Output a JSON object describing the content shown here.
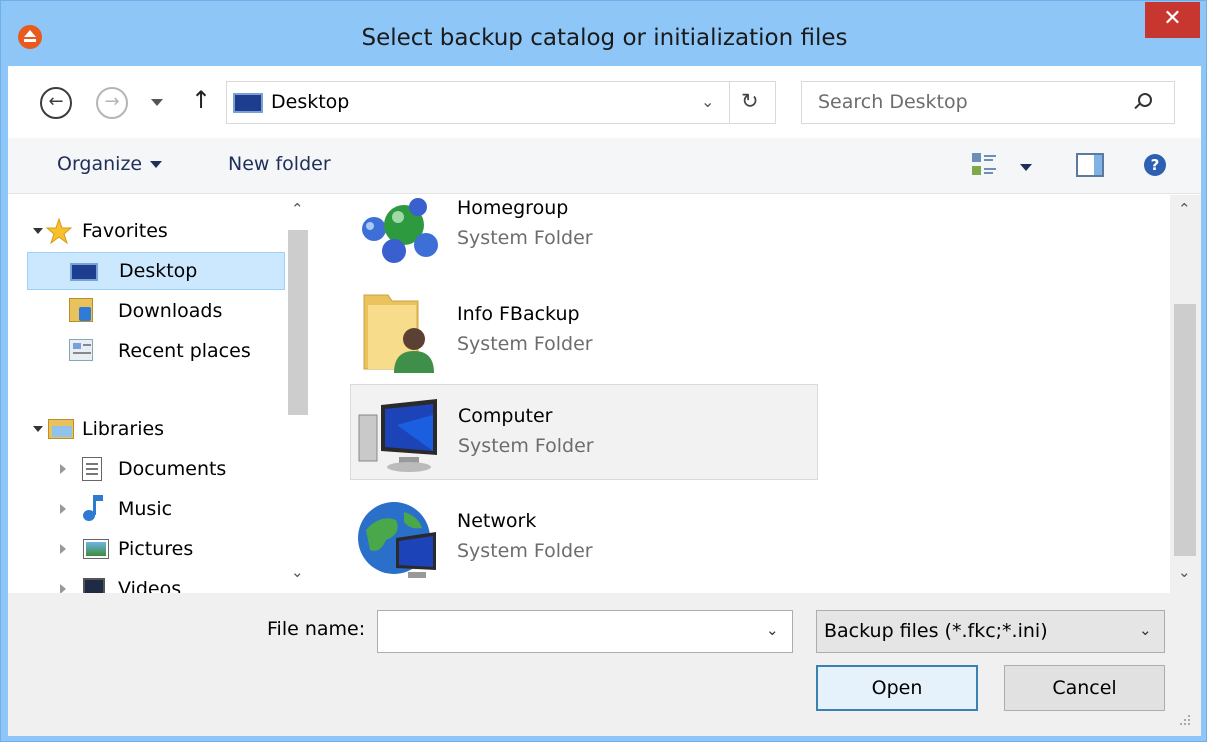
{
  "window": {
    "title": "Select backup catalog or initialization files",
    "close_label": "✕"
  },
  "address": {
    "location": "Desktop",
    "chevron": "⌄",
    "refresh": "↻"
  },
  "search": {
    "placeholder": "Search Desktop"
  },
  "toolbar": {
    "organize_label": "Organize",
    "new_folder_label": "New folder",
    "help_label": "?"
  },
  "nav_pane": {
    "favorites_label": "Favorites",
    "favorites": [
      {
        "label": "Desktop",
        "icon": "desktop-icon",
        "selected": true
      },
      {
        "label": "Downloads",
        "icon": "downloads-icon",
        "selected": false
      },
      {
        "label": "Recent places",
        "icon": "recent-places-icon",
        "selected": false
      }
    ],
    "libraries_label": "Libraries",
    "libraries": [
      {
        "label": "Documents",
        "icon": "documents-icon"
      },
      {
        "label": "Music",
        "icon": "music-icon"
      },
      {
        "label": "Pictures",
        "icon": "pictures-icon"
      },
      {
        "label": "Videos",
        "icon": "videos-icon"
      }
    ]
  },
  "files": [
    {
      "name": "Homegroup",
      "type": "System Folder",
      "icon": "homegroup-icon",
      "selected": false
    },
    {
      "name": "Info FBackup",
      "type": "System Folder",
      "icon": "user-folder-icon",
      "selected": false
    },
    {
      "name": "Computer",
      "type": "System Folder",
      "icon": "computer-icon",
      "selected": true
    },
    {
      "name": "Network",
      "type": "System Folder",
      "icon": "network-icon",
      "selected": false
    }
  ],
  "bottom": {
    "file_name_label": "File name:",
    "file_name_value": "",
    "filter_value": "Backup files (*.fkc;*.ini)",
    "open_label": "Open",
    "cancel_label": "Cancel"
  },
  "colors": {
    "title_bar": "#8ec7f7",
    "close_button": "#c7372f",
    "selection": "#cce8ff"
  }
}
